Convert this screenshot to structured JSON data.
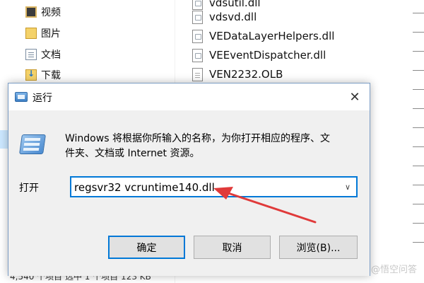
{
  "explorer": {
    "nav_items": [
      {
        "label": "视频",
        "icon": "video-folder-icon"
      },
      {
        "label": "图片",
        "icon": "pictures-folder-icon"
      },
      {
        "label": "文档",
        "icon": "documents-folder-icon"
      },
      {
        "label": "下载",
        "icon": "downloads-folder-icon"
      }
    ],
    "files": [
      {
        "name": "vdsutil.dll",
        "icon": "dll-file-icon"
      },
      {
        "name": "vdsvd.dll",
        "icon": "dll-file-icon"
      },
      {
        "name": "VEDataLayerHelpers.dll",
        "icon": "dll-file-icon"
      },
      {
        "name": "VEEventDispatcher.dll",
        "icon": "dll-file-icon"
      },
      {
        "name": "VEN2232.OLB",
        "icon": "generic-file-icon"
      }
    ],
    "status_text": "4,540 个项目    选中 1 个项目  123 KB"
  },
  "watermark": {
    "text": "@悟空问答"
  },
  "run_dialog": {
    "title": "运行",
    "description_line1": "Windows 将根据你所输入的名称，为你打开相应的程序、文",
    "description_line2": "件夹、文档或 Internet 资源。",
    "open_label": "打开",
    "command_value": "regsvr32 vcruntime140.dll",
    "ok_label": "确定",
    "cancel_label": "取消",
    "browse_label": "浏览(B)...",
    "close_glyph": "✕",
    "dropdown_glyph": "∨"
  },
  "colors": {
    "accent": "#0078d7",
    "annotation_arrow": "#e03a3a",
    "dialog_background": "#f0f0f0"
  }
}
